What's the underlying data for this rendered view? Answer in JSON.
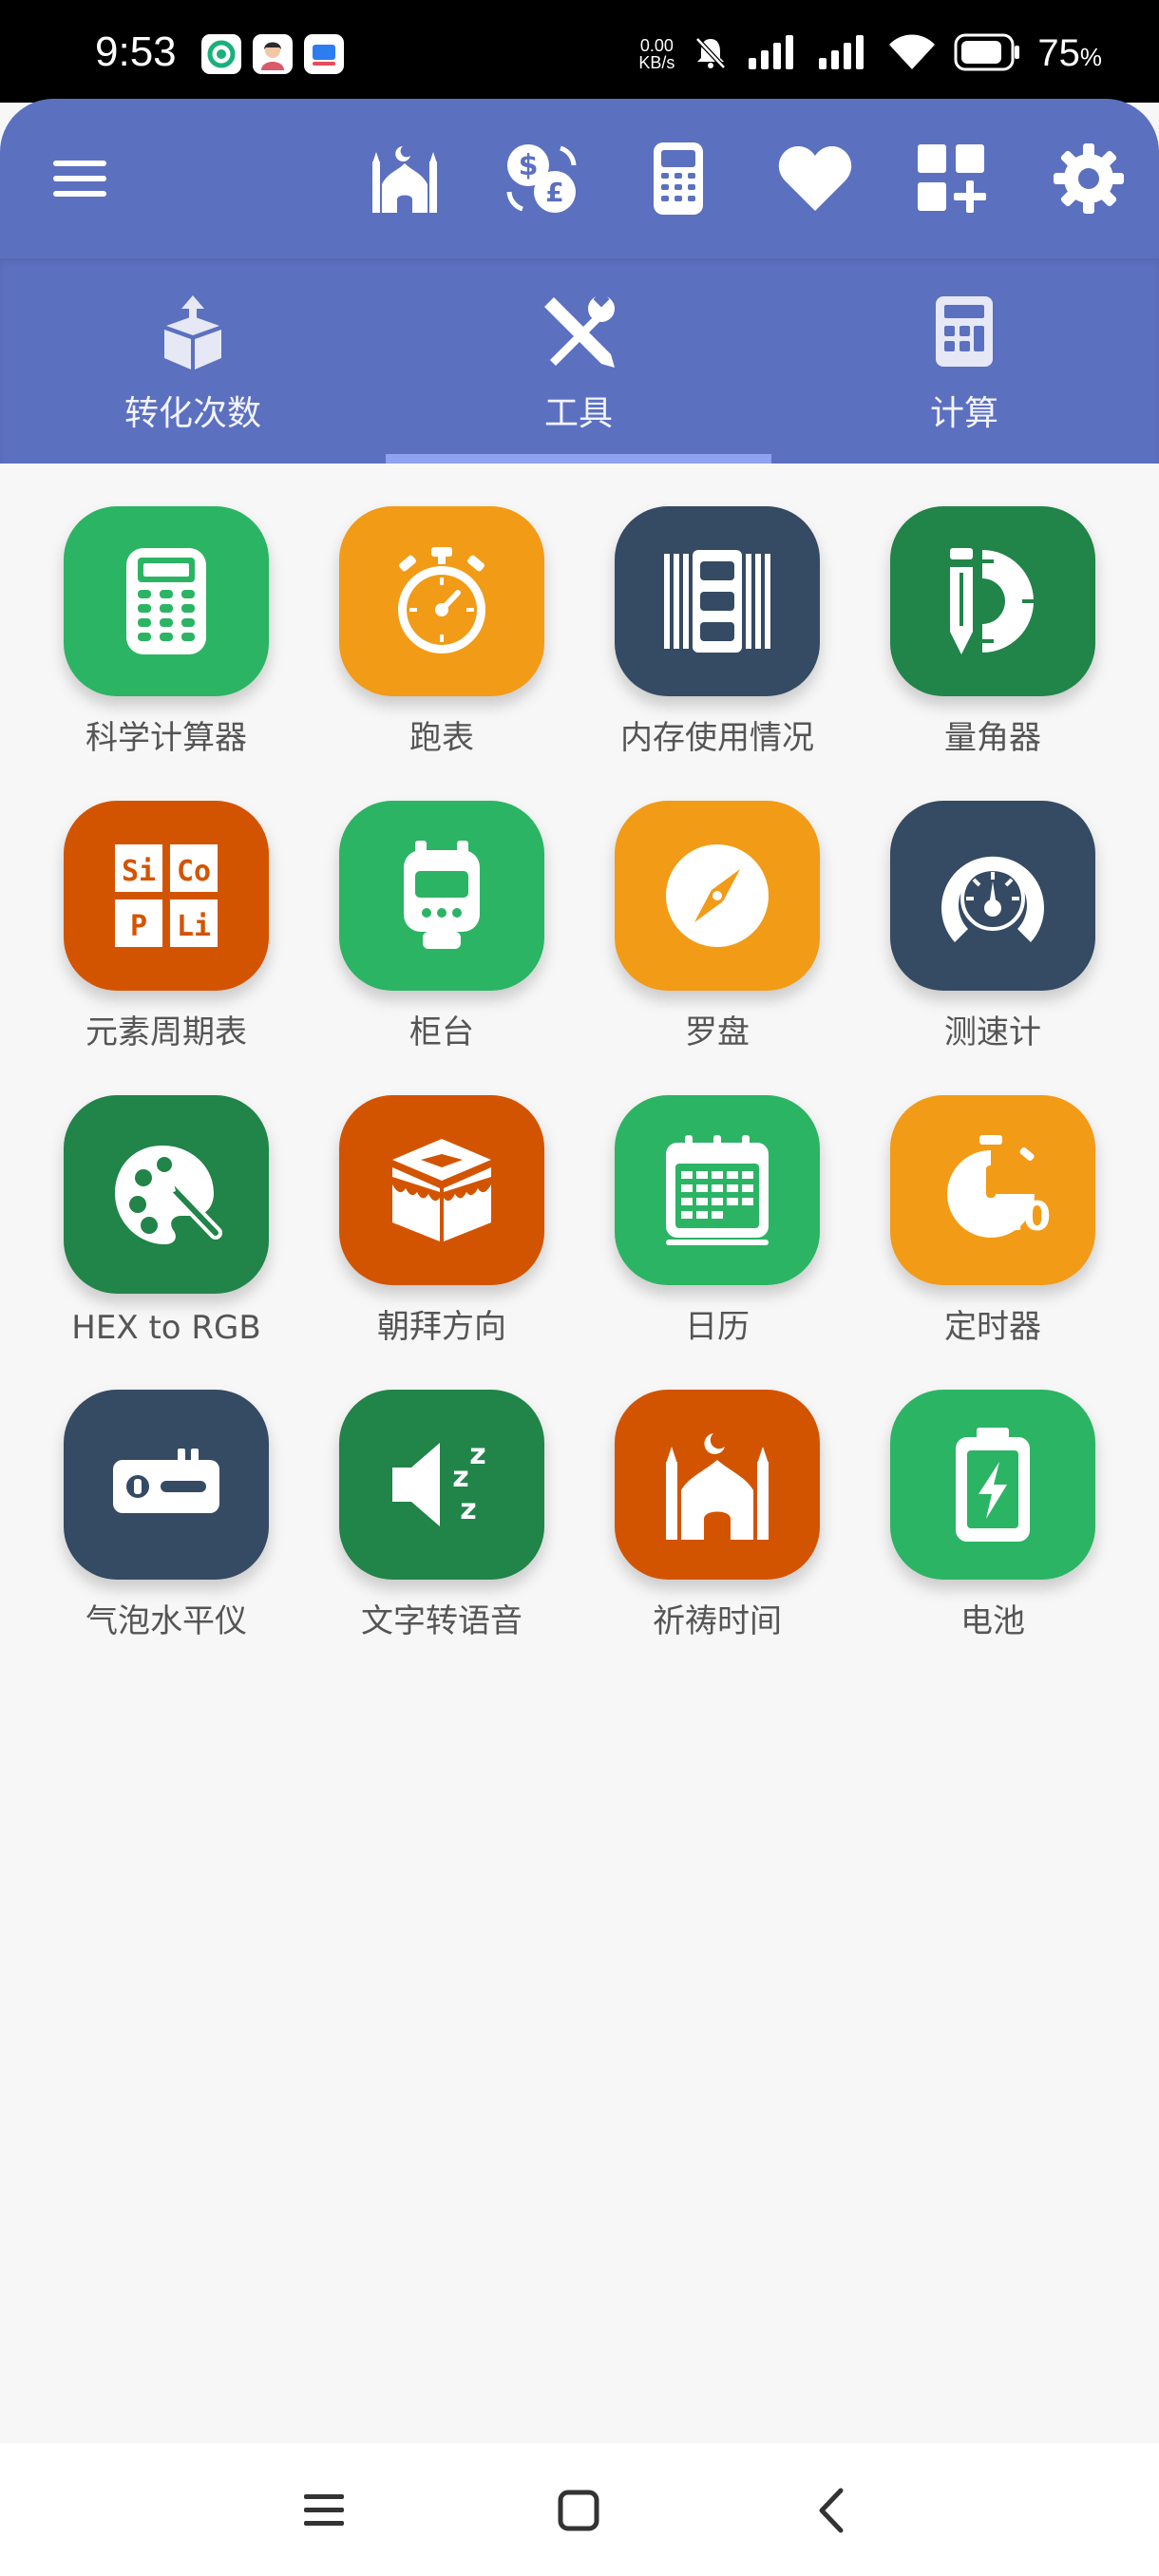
{
  "status_bar": {
    "time": "9:53",
    "net_speed_value": "0.00",
    "net_speed_unit": "KB/s",
    "battery_value": "75",
    "battery_unit": "%"
  },
  "colors": {
    "primary": "#5c70c0",
    "green": "#2bb464",
    "dark_green": "#218449",
    "orange": "#f29b17",
    "red_orange": "#d35400",
    "navy": "#354a63",
    "indicator": "#8fa2ef"
  },
  "toolbar": {
    "icons": [
      "menu-icon",
      "mosque-icon",
      "currency-exchange-icon",
      "calculator-icon",
      "heart-icon",
      "add-widget-icon",
      "gear-icon"
    ]
  },
  "tabs": [
    {
      "label": "转化次数",
      "icon": "conversion-icon",
      "selected": false
    },
    {
      "label": "工具",
      "icon": "tools-icon",
      "selected": true
    },
    {
      "label": "计算",
      "icon": "calculator-icon",
      "selected": false
    }
  ],
  "tools": [
    {
      "label": "科学计算器",
      "icon": "scientific-calculator-icon",
      "color": "#2bb464"
    },
    {
      "label": "跑表",
      "icon": "stopwatch-icon",
      "color": "#f29b17"
    },
    {
      "label": "内存使用情况",
      "icon": "memory-icon",
      "color": "#354a63"
    },
    {
      "label": "量角器",
      "icon": "protractor-icon",
      "color": "#218449"
    },
    {
      "label": "元素周期表",
      "icon": "periodic-table-icon",
      "color": "#d35400"
    },
    {
      "label": "柜台",
      "icon": "counter-icon",
      "color": "#2bb464"
    },
    {
      "label": "罗盘",
      "icon": "compass-icon",
      "color": "#f29b17"
    },
    {
      "label": "测速计",
      "icon": "speedometer-icon",
      "color": "#354a63"
    },
    {
      "label": "HEX to RGB",
      "icon": "palette-icon",
      "color": "#218449"
    },
    {
      "label": "朝拜方向",
      "icon": "kaaba-icon",
      "color": "#d35400"
    },
    {
      "label": "日历",
      "icon": "calendar-icon",
      "color": "#2bb464"
    },
    {
      "label": "定时器",
      "icon": "timer-icon",
      "color": "#f29b17"
    },
    {
      "label": "气泡水平仪",
      "icon": "bubble-level-icon",
      "color": "#354a63"
    },
    {
      "label": "文字转语音",
      "icon": "text-to-speech-icon",
      "color": "#218449"
    },
    {
      "label": "祈祷时间",
      "icon": "prayer-time-icon",
      "color": "#d35400"
    },
    {
      "label": "电池",
      "icon": "battery-icon",
      "color": "#2bb464"
    }
  ],
  "periodic_icon_text": [
    "Si",
    "Co",
    "P",
    "Li"
  ],
  "timer_icon_text": "10",
  "navigation": {
    "icons": [
      "recent-apps-icon",
      "home-icon",
      "back-icon"
    ]
  }
}
